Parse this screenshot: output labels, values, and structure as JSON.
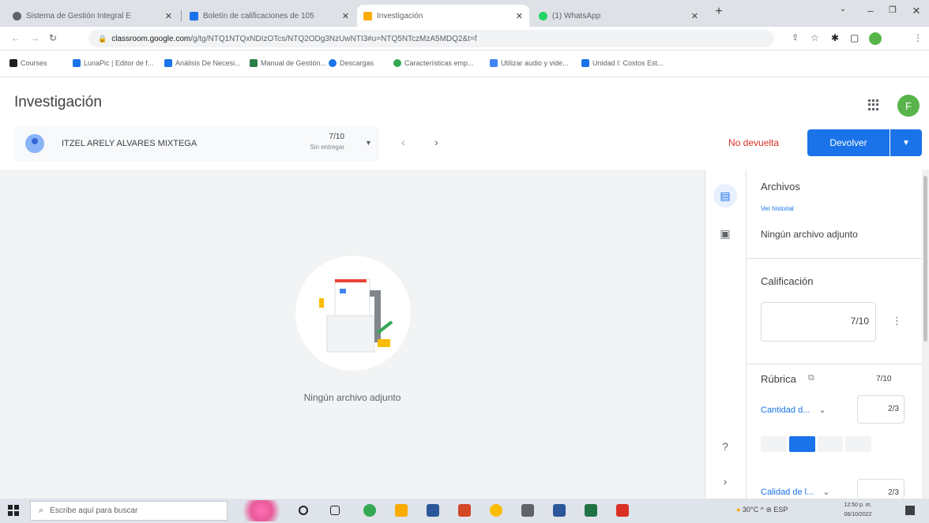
{
  "browser": {
    "tabs": [
      {
        "label": "Sistema de Gestión Integral E",
        "color": "#5f6368"
      },
      {
        "label": "Boletín de calificaciones de 105",
        "color": "#1a73e8"
      },
      {
        "label": "Investigación",
        "color": "#f9ab00"
      },
      {
        "label": "(1) WhatsApp",
        "color": "#25d366"
      }
    ],
    "url_host": "classroom.google.com",
    "url_path": "/g/tg/NTQ1NTQxNDIzOTcs/NTQ2ODg3NzUwNTI3#u=NTQ5NTczMzA5MDQ2&t=f",
    "bookmarks": [
      "Courses",
      "LunaPic | Editor de f...",
      "Análisis De Necesi...",
      "Manual de Gestión...",
      "Descargas",
      "Características emp...",
      "Utilizar audio y vide...",
      "Unidad I: Costos Est..."
    ]
  },
  "header": {
    "title": "Investigación",
    "avatar_letter": "F"
  },
  "student": {
    "name": "ITZEL ARELY ALVARES MIXTEGA",
    "score": "7/10",
    "status": "Sin entregar"
  },
  "actions": {
    "status": "No devuelta",
    "return_label": "Devolver"
  },
  "viewer": {
    "message": "Ningún archivo adjunto"
  },
  "panel": {
    "files_title": "Archivos",
    "history_link": "Ver historial",
    "files_empty": "Ningún archivo adjunto",
    "grade_title": "Calificación",
    "grade_value": "7/10",
    "rubric_title": "Rúbrica",
    "rubric_score": "7/10",
    "criteria": [
      {
        "label": "Cantidad d...",
        "score": "2/3"
      },
      {
        "label": "Calidad de l...",
        "score": "2/3"
      }
    ]
  },
  "taskbar": {
    "search_placeholder": "Escribe aquí para buscar",
    "weather": "30°C",
    "lang": "ESP",
    "time": "12:50 p. m.",
    "date": "06/10/2022"
  }
}
